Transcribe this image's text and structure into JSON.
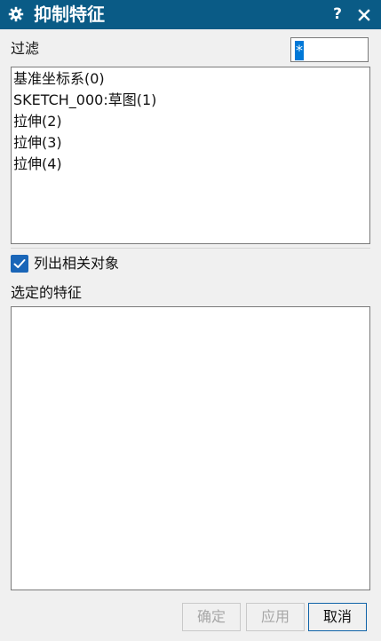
{
  "window": {
    "title": "抑制特征",
    "help": "?"
  },
  "filter": {
    "label": "过滤",
    "value": "*"
  },
  "features": [
    "基准坐标系(0)",
    "SKETCH_000:草图(1)",
    "拉伸(2)",
    "拉伸(3)",
    "拉伸(4)"
  ],
  "list_related": {
    "label": "列出相关对象",
    "checked": true
  },
  "selected": {
    "label": "选定的特征",
    "items": []
  },
  "buttons": {
    "ok": "确定",
    "apply": "应用",
    "cancel": "取消"
  }
}
